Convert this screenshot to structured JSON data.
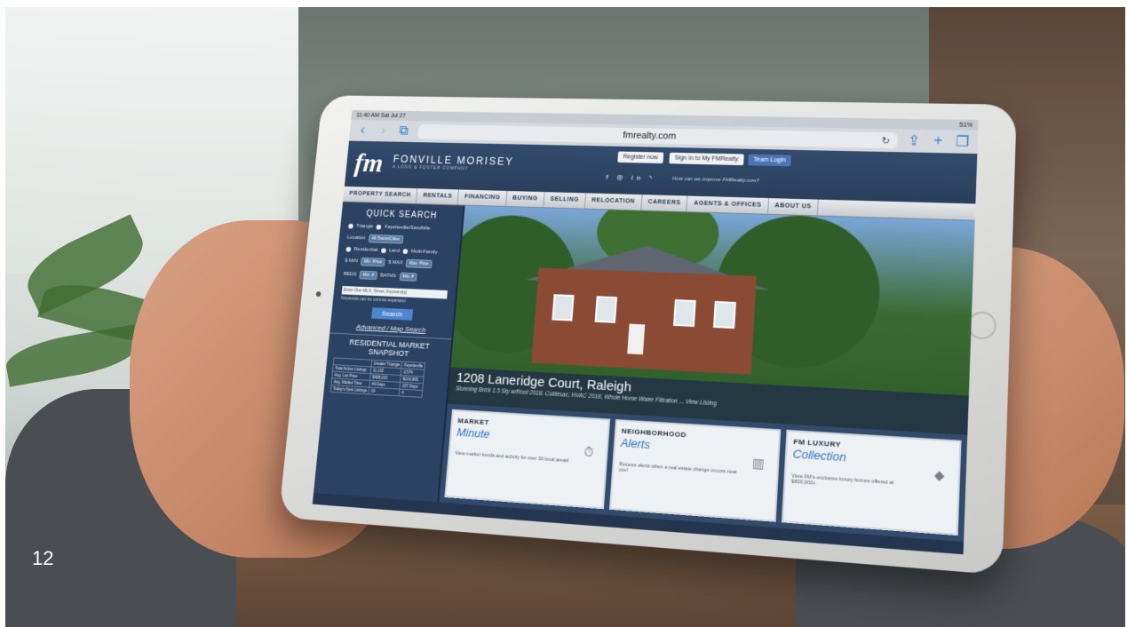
{
  "slide": {
    "page_number": "12"
  },
  "ipad": {
    "status": {
      "time": "11:40 AM  Sat Jul 27",
      "battery": "51%"
    },
    "browser": {
      "url": "fmrealty.com",
      "icons": [
        "chevron-left-icon",
        "chevron-right-icon",
        "book-icon",
        "reload-icon",
        "share-icon",
        "plus-icon",
        "tabs-icon"
      ]
    },
    "site": {
      "logo": "fm",
      "brand": "FONVILLE MORISEY",
      "tagline": "A LONG & FOSTER COMPANY",
      "header_buttons": [
        "Register now",
        "Sign In to My FMRealty",
        "Team Login"
      ],
      "improve_text": "How can we improve FMRealty.com?",
      "menu": [
        "PROPERTY SEARCH",
        "RENTALS",
        "FINANCING",
        "BUYING",
        "SELLING",
        "RELOCATION",
        "CAREERS",
        "AGENTS & OFFICES",
        "ABOUT US"
      ],
      "quick_search": {
        "title": "QUICK SEARCH",
        "regions": [
          "Triangle",
          "Fayetteville/Sandhills"
        ],
        "location_label": "Location",
        "location_value": "All Towns/Cities",
        "types": [
          "Residential",
          "Land",
          "Multi-Family"
        ],
        "min_label": "$ MIN",
        "min_value": "Min. Price",
        "max_label": "$ MAX",
        "max_value": "Max. Price",
        "beds_label": "BEDS",
        "beds_value": "Min. #",
        "baths_label": "BATHS",
        "baths_value": "Min. #",
        "keyword_placeholder": "Enter One MLS, Street, Keyword(s)",
        "keyword_note": "Keywords can be comma separated",
        "search_button": "Search",
        "advanced_link": "Advanced / Map Search"
      },
      "market_snapshot": {
        "title": "RESIDENTIAL MARKET SNAPSHOT",
        "columns": [
          "",
          "Greater Triangle",
          "Fayetteville"
        ],
        "rows": [
          [
            "Total Active Listings",
            "11,132",
            "2,674"
          ],
          [
            "Avg. List Price",
            "$408,015",
            "$219,683"
          ],
          [
            "Avg. Market Time",
            "49 Days",
            "107 Days"
          ],
          [
            "Today's New Listings",
            "19",
            "4"
          ]
        ]
      },
      "hero": {
        "title": "1208 Laneridge Court, Raleigh",
        "subtitle": "Stunning Brick 1.5 Sty w/Roof 2018, Culdesac, HVAC 2018, Whole Home Water Filtration ...",
        "link": "View Listing"
      },
      "cards": [
        {
          "heading": "MARKET",
          "script": "Minute",
          "icon": "stopwatch-icon",
          "text": "View market trends and activity for over 30 local areas!"
        },
        {
          "heading": "NEIGHBORHOOD",
          "script": "Alerts",
          "icon": "buildings-icon",
          "text": "Receive alerts when a real estate change occurs near you!"
        },
        {
          "heading": "FM LUXURY",
          "script": "Collection",
          "icon": "diamond-icon",
          "text": "View FM's exclusive luxury homes offered at $800,000+."
        }
      ]
    }
  }
}
